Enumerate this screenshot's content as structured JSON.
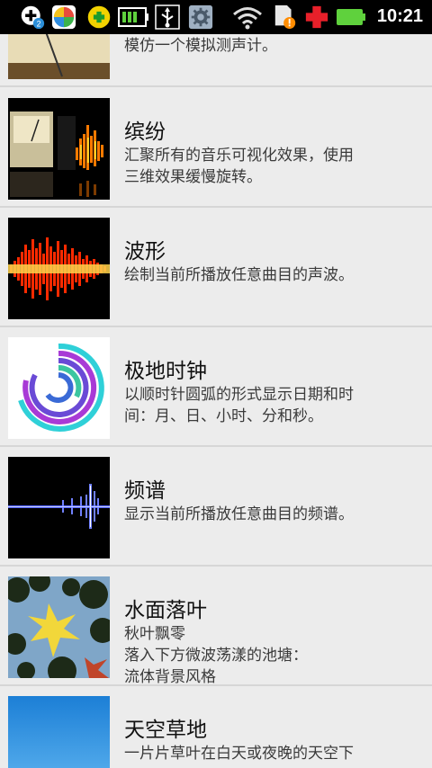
{
  "status_bar": {
    "notification_count": "2",
    "time": "10:21",
    "icons": [
      "add-icon",
      "store-app-icon",
      "plus-app-icon",
      "battery-saver-icon",
      "usb-icon",
      "settings-icon",
      "wifi-icon",
      "sd-warning-icon",
      "medical-cross-icon",
      "battery-icon"
    ],
    "accent_colors": {
      "battery": "#5fd13d",
      "warning": "#ff8c00",
      "cross": "#e8202a"
    }
  },
  "wallpapers": [
    {
      "title": "",
      "description": "模仿一个模拟测声计。",
      "thumb_icon": "vu-meter-thumbnail"
    },
    {
      "title": "缤纷",
      "description": "汇聚所有的音乐可视化效果，使用\n三维效果缓慢旋转。",
      "thumb_icon": "mix-visualizer-thumbnail"
    },
    {
      "title": "波形",
      "description": "绘制当前所播放任意曲目的声波。",
      "thumb_icon": "waveform-thumbnail"
    },
    {
      "title": "极地时钟",
      "description": "以顺时针圆弧的形式显示日期和时\n间：月、日、小时、分和秒。",
      "thumb_icon": "polar-clock-thumbnail"
    },
    {
      "title": "频谱",
      "description": "显示当前所播放任意曲目的频谱。",
      "thumb_icon": "spectrum-thumbnail"
    },
    {
      "title": "水面落叶",
      "description": "秋叶飘零\n落入下方微波荡漾的池塘：\n流体背景风格",
      "thumb_icon": "falling-leaves-thumbnail"
    },
    {
      "title": "天空草地",
      "description": "一片片草叶在白天或夜晚的天空下",
      "thumb_icon": "grass-sky-thumbnail"
    }
  ]
}
